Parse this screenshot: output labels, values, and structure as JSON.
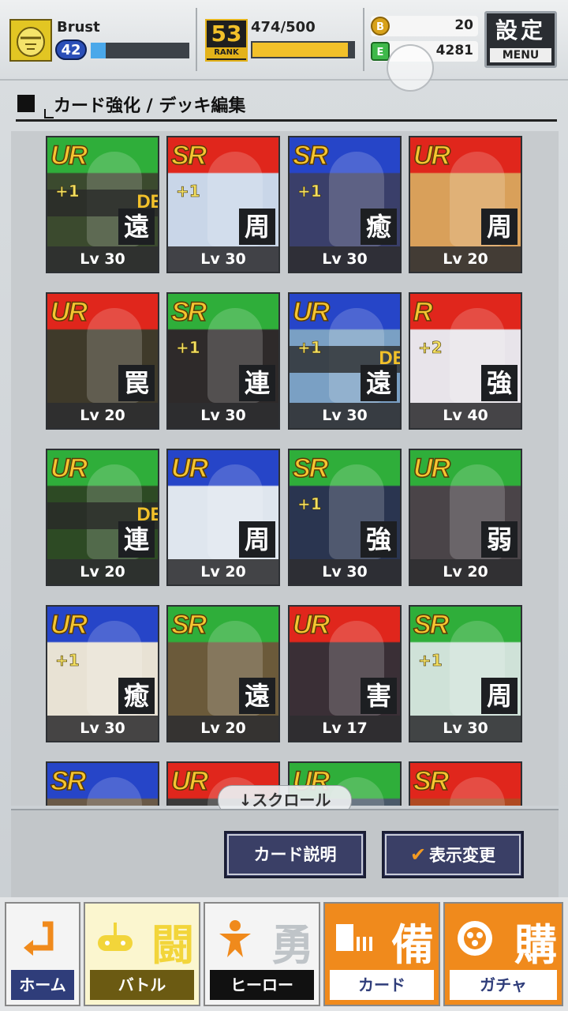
{
  "header": {
    "player_name": "Brust",
    "level": "42",
    "exp_fraction": 0.15,
    "rank": "53",
    "rank_label": "RANK",
    "stamina_text": "474/500",
    "stamina_fraction": 0.948,
    "currency_1": {
      "icon": "coin-icon",
      "value": "20"
    },
    "currency_2": {
      "icon": "gem-icon",
      "value": "4281"
    },
    "menu_kanji": "設定",
    "menu_label": "MENU"
  },
  "section": {
    "title": "カード強化 / デッキ編集"
  },
  "cards": [
    {
      "rarity": "UR",
      "plus": "+1",
      "deck": "DEC",
      "type": "遠",
      "level": "Lv 30",
      "header_color": "#2fae3a",
      "art_color": "#3b4a2e"
    },
    {
      "rarity": "SR",
      "plus": "+1",
      "deck": "",
      "type": "周",
      "level": "Lv 30",
      "header_color": "#e0261c",
      "art_color": "#c9d6e8"
    },
    {
      "rarity": "SR",
      "plus": "+1",
      "deck": "",
      "type": "癒",
      "level": "Lv 30",
      "header_color": "#2645c8",
      "art_color": "#3a3f6a"
    },
    {
      "rarity": "UR",
      "plus": "",
      "deck": "",
      "type": "周",
      "level": "Lv 20",
      "header_color": "#e0261c",
      "art_color": "#d9a05a"
    },
    {
      "rarity": "UR",
      "plus": "",
      "deck": "",
      "type": "罠",
      "level": "Lv 20",
      "header_color": "#e0261c",
      "art_color": "#3f3a2a"
    },
    {
      "rarity": "SR",
      "plus": "+1",
      "deck": "",
      "type": "連",
      "level": "Lv 30",
      "header_color": "#2fae3a",
      "art_color": "#2e2a2a"
    },
    {
      "rarity": "UR",
      "plus": "+1",
      "deck": "DEC",
      "type": "遠",
      "level": "Lv 30",
      "header_color": "#2645c8",
      "art_color": "#7aa0c4"
    },
    {
      "rarity": "R",
      "plus": "+2",
      "deck": "",
      "type": "強",
      "level": "Lv 40",
      "header_color": "#e0261c",
      "art_color": "#e8e4ea"
    },
    {
      "rarity": "UR",
      "plus": "",
      "deck": "DEC",
      "type": "連",
      "level": "Lv 20",
      "header_color": "#2fae3a",
      "art_color": "#2d4a24"
    },
    {
      "rarity": "UR",
      "plus": "",
      "deck": "",
      "type": "周",
      "level": "Lv 20",
      "header_color": "#2645c8",
      "art_color": "#dfe6ee"
    },
    {
      "rarity": "SR",
      "plus": "+1",
      "deck": "",
      "type": "強",
      "level": "Lv 30",
      "header_color": "#2fae3a",
      "art_color": "#2a3550"
    },
    {
      "rarity": "UR",
      "plus": "",
      "deck": "",
      "type": "弱",
      "level": "Lv 20",
      "header_color": "#2fae3a",
      "art_color": "#4a4448"
    },
    {
      "rarity": "UR",
      "plus": "+1",
      "deck": "",
      "type": "癒",
      "level": "Lv 30",
      "header_color": "#2645c8",
      "art_color": "#e8e2d4"
    },
    {
      "rarity": "SR",
      "plus": "",
      "deck": "",
      "type": "遠",
      "level": "Lv 20",
      "header_color": "#2fae3a",
      "art_color": "#6b5a3a"
    },
    {
      "rarity": "UR",
      "plus": "",
      "deck": "",
      "type": "害",
      "level": "Lv 17",
      "header_color": "#e0261c",
      "art_color": "#3a2f36"
    },
    {
      "rarity": "SR",
      "plus": "+1",
      "deck": "",
      "type": "周",
      "level": "Lv 30",
      "header_color": "#2fae3a",
      "art_color": "#cfe2d8"
    },
    {
      "rarity": "SR",
      "plus": "",
      "deck": "",
      "type": "",
      "level": "",
      "header_color": "#2645c8",
      "art_color": "#6a5a48"
    },
    {
      "rarity": "UR",
      "plus": "",
      "deck": "",
      "type": "",
      "level": "",
      "header_color": "#e0261c",
      "art_color": "#3a3a3a"
    },
    {
      "rarity": "UR",
      "plus": "",
      "deck": "",
      "type": "",
      "level": "",
      "header_color": "#2fae3a",
      "art_color": "#4a5a6a"
    },
    {
      "rarity": "SR",
      "plus": "",
      "deck": "",
      "type": "",
      "level": "",
      "header_color": "#e0261c",
      "art_color": "#b04a22"
    }
  ],
  "scroll_hint": "↓スクロール",
  "actions": {
    "card_description": "カード説明",
    "check_icon": "✔",
    "display_change": "表示変更"
  },
  "nav": [
    {
      "kanji": "",
      "label": "ホーム",
      "icon": "home-icon",
      "tab_bg": "#f4f4f4",
      "label_bg": "#2f3d7a",
      "label_color": "#ffffff",
      "accent": "#f08a1c"
    },
    {
      "kanji": "闘",
      "label": "バトル",
      "icon": "gamepad-icon",
      "tab_bg": "#fbf6cf",
      "label_bg": "#6b5a12",
      "label_color": "#ffffff",
      "accent": "#f2d53a"
    },
    {
      "kanji": "勇",
      "label": "ヒーロー",
      "icon": "hero-icon",
      "tab_bg": "#f4f4f4",
      "label_bg": "#111111",
      "label_color": "#ffffff",
      "accent": "#f08a1c"
    },
    {
      "kanji": "備",
      "label": "カード",
      "icon": "cards-icon",
      "tab_bg": "#f08a1c",
      "label_bg": "#ffffff",
      "label_color": "#2f3d7a",
      "accent": "#ffffff"
    },
    {
      "kanji": "購",
      "label": "ガチャ",
      "icon": "gacha-icon",
      "tab_bg": "#f08a1c",
      "label_bg": "#ffffff",
      "label_color": "#2f3d7a",
      "accent": "#ffffff"
    }
  ]
}
